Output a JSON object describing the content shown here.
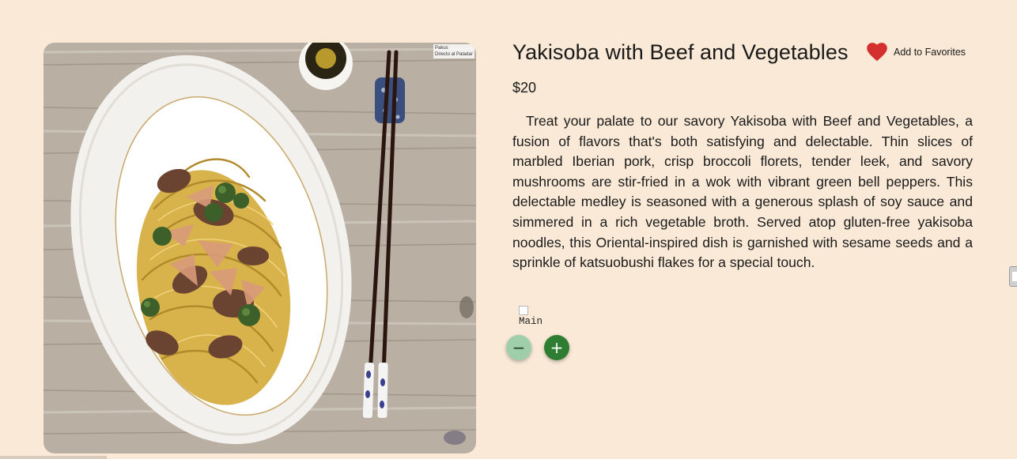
{
  "product": {
    "title": "Yakisoba with Beef and Vegetables",
    "price": "$20",
    "description": "Treat your palate to our savory Yakisoba with Beef and Vegetables, a fusion of flavors that's both satisfying and delectable. Thin slices of marbled Iberian pork, crisp broccoli florets, tender leek, and savory mushrooms are stir-fried in a wok with vibrant green bell peppers. This delectable medley is seasoned with a generous splash of soy sauce and simmered in a rich vegetable broth. Served atop gluten-free yakisoba noodles, this Oriental-inspired dish is garnished with sesame seeds and a sprinkle of katsuobushi flakes for a special touch.",
    "image_watermark_line1": "Pakus",
    "image_watermark_line2": "Directo al Paladar",
    "broken_image_alt": "Main"
  },
  "favorites": {
    "label": "Add to Favorites",
    "icon": "heart-icon",
    "color": "#d32f2f"
  },
  "quantity": {
    "minus_label": "−",
    "plus_label": "+",
    "minus_color": "#9fceaa",
    "plus_color": "#2e7d32"
  },
  "theme": {
    "background": "#f9e9d6"
  }
}
